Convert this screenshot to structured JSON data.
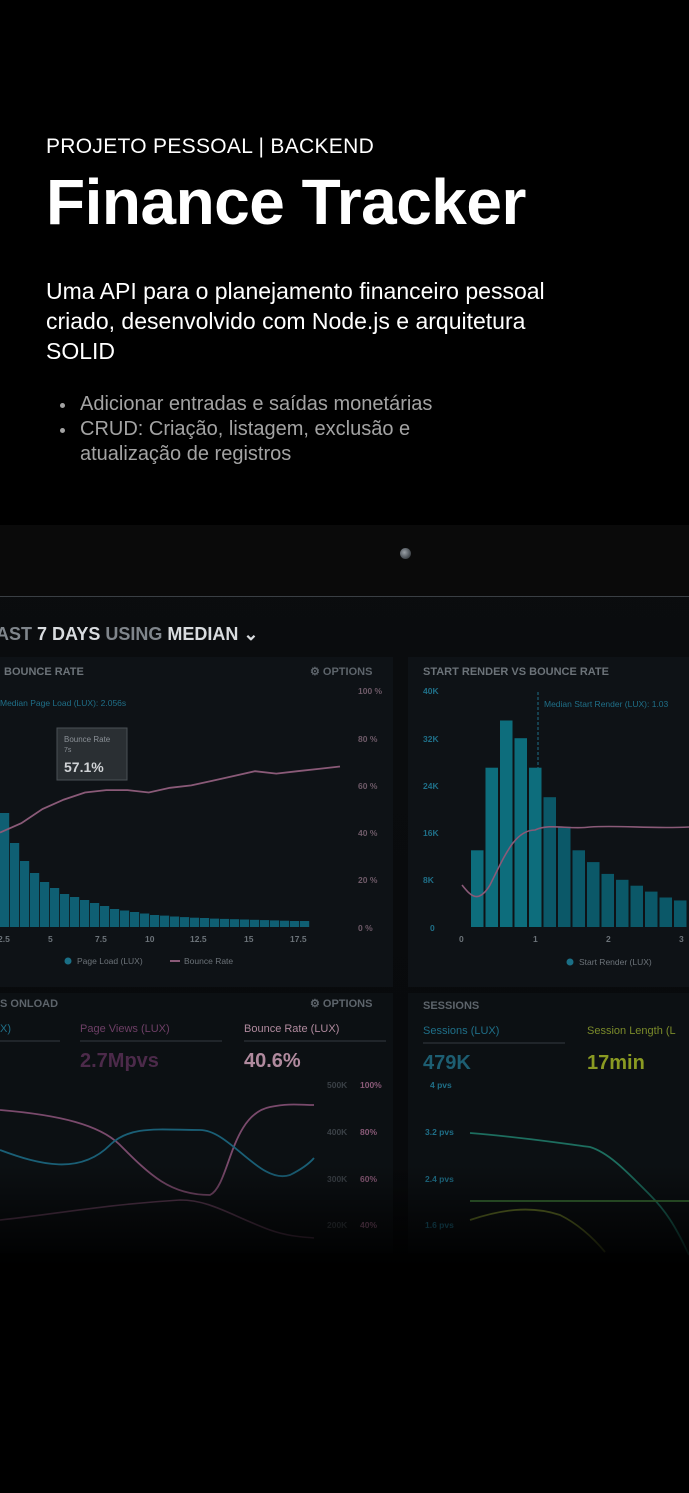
{
  "hero": {
    "eyebrow": "PROJETO PESSOAL | BACKEND",
    "title": "Finance Tracker",
    "description": "Uma API para o planejamento financeiro pessoal criado, desenvolvido com Node.js e arquitetura SOLID",
    "bullets": [
      "Adicionar entradas e saídas monetárias",
      "CRUD: Criação, listagem, exclusão e atualização de registros"
    ]
  },
  "dashboard": {
    "title_prefix": "AST ",
    "title_bold": "7 DAYS",
    "title_mid": " USING ",
    "title_bold2": "MEDIAN",
    "panels": {
      "bounce": {
        "title": "BOUNCE RATE",
        "options": "⚙ OPTIONS",
        "median_label": "Median Page Load (LUX): 2.056s",
        "tooltip_title": "Bounce Rate",
        "tooltip_sub": "7s",
        "tooltip_value": "57.1%",
        "legend_a": "Page Load (LUX)",
        "legend_b": "Bounce Rate"
      },
      "render": {
        "title": "START RENDER VS BOUNCE RATE",
        "median_label": "Median Start Render (LUX): 1.03",
        "legend_a": "Start Render (LUX)"
      },
      "onload": {
        "title": "S ONLOAD",
        "options": "⚙ OPTIONS",
        "col_a": "X)",
        "col_b": "Page Views (LUX)",
        "col_c": "Bounce Rate (LUX)",
        "val_b": "2.7Mpvs",
        "val_c": "40.6%"
      },
      "sessions": {
        "title": "SESSIONS",
        "col_a": "Sessions (LUX)",
        "col_b": "Session Length (L",
        "val_a": "479K",
        "val_b": "17min"
      }
    }
  },
  "chart_data": [
    {
      "type": "bar",
      "title": "BOUNCE RATE",
      "x_ticks": [
        "2.5",
        "5",
        "7.5",
        "10",
        "12.5",
        "15",
        "17.5"
      ],
      "y_right_ticks": [
        "100 %",
        "80 %",
        "60 %",
        "40 %",
        "20 %",
        "0 %"
      ],
      "series": [
        {
          "name": "Page Load (LUX)",
          "type": "bar",
          "values": [
            38,
            28,
            22,
            18,
            15,
            13,
            11,
            10,
            9,
            8,
            7,
            6,
            5.5,
            5,
            4.5,
            4,
            3.8,
            3.5,
            3.3,
            3.1,
            3,
            2.8,
            2.7,
            2.6,
            2.5,
            2.4,
            2.3,
            2.2,
            2.1,
            2,
            2
          ]
        },
        {
          "name": "Bounce Rate",
          "type": "line",
          "values": [
            40,
            44,
            50,
            54,
            57,
            58,
            58,
            57,
            59,
            60,
            62,
            64,
            66,
            65,
            66,
            67,
            68
          ]
        }
      ]
    },
    {
      "type": "bar",
      "title": "START RENDER VS BOUNCE RATE",
      "x_ticks": [
        "0",
        "1",
        "2",
        "3"
      ],
      "y_ticks": [
        "40K",
        "32K",
        "24K",
        "16K",
        "8K",
        "0"
      ],
      "series": [
        {
          "name": "Start Render (LUX)",
          "type": "bar",
          "values": [
            13,
            27,
            35,
            32,
            27,
            22,
            17,
            13,
            11,
            9,
            8,
            7,
            6,
            5,
            4.5
          ]
        }
      ]
    }
  ],
  "colors": {
    "accent_teal": "#0f7b8a",
    "line_pink": "#b06a8a",
    "text_gray": "#a3a3a3"
  }
}
